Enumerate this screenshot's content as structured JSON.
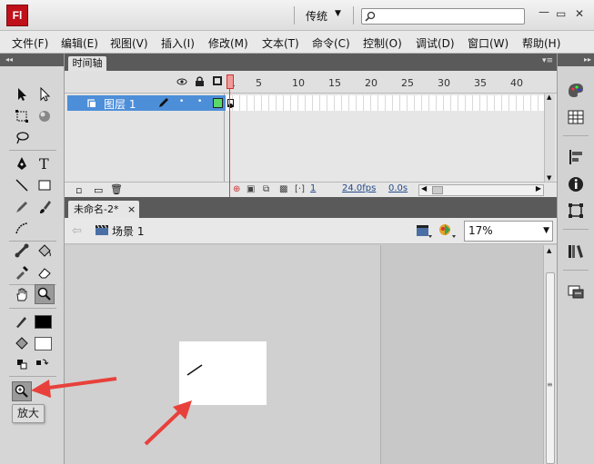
{
  "app": {
    "logo": "Fl",
    "workspace": "传统",
    "search_placeholder": ""
  },
  "menu": [
    "文件(F)",
    "编辑(E)",
    "视图(V)",
    "插入(I)",
    "修改(M)",
    "文本(T)",
    "命令(C)",
    "控制(O)",
    "调试(D)",
    "窗口(W)",
    "帮助(H)"
  ],
  "timeline": {
    "tab_label": "时间轴",
    "frame_numbers": [
      "1",
      "5",
      "10",
      "15",
      "20",
      "25",
      "30",
      "35",
      "40"
    ],
    "layer_name": "图层 1",
    "current_frame": "1",
    "fps": "24.0fps",
    "time": "0.0s"
  },
  "document": {
    "tab_label": "未命名-2*",
    "close_glyph": "×",
    "scene_name": "场景 1",
    "zoom": "17%"
  },
  "tooltip": "放大",
  "colors": {
    "accent_red": "#c0101a",
    "layer_blue": "#4d8ed8",
    "arrow_red": "#e8413b"
  }
}
